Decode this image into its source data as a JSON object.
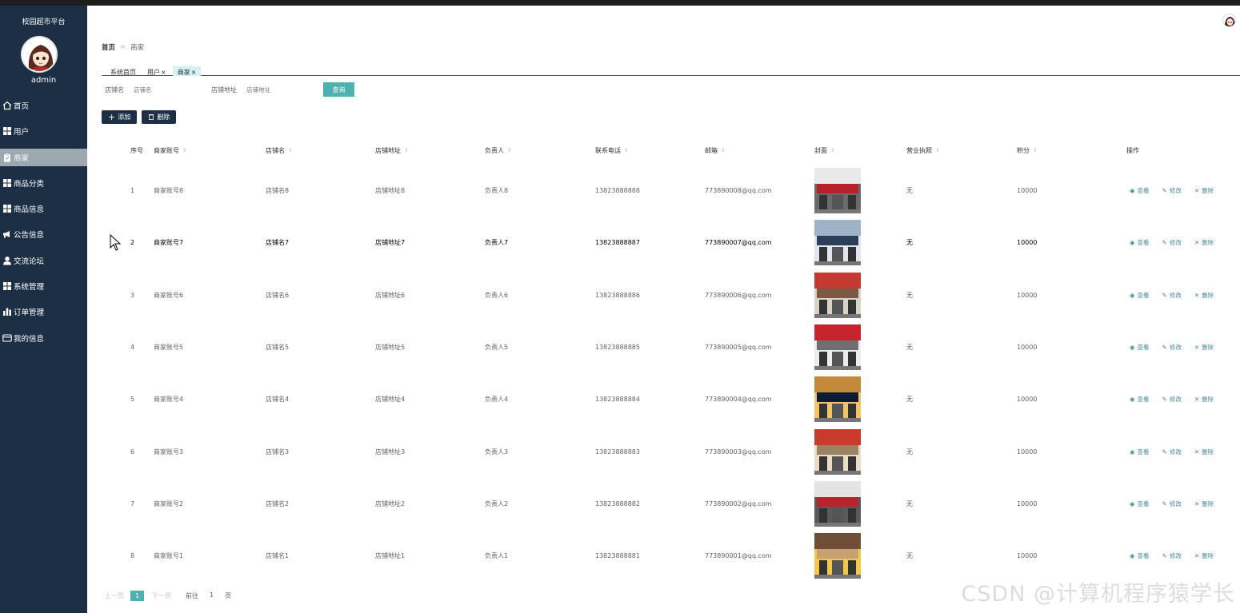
{
  "app": {
    "title": "校园超市平台",
    "user": "admin"
  },
  "menu": [
    {
      "label": "首页",
      "icon": "home-icon"
    },
    {
      "label": "用户",
      "icon": "grid-icon"
    },
    {
      "label": "商家",
      "icon": "clipboard-icon",
      "active": true
    },
    {
      "label": "商品分类",
      "icon": "grid-icon"
    },
    {
      "label": "商品信息",
      "icon": "grid-icon"
    },
    {
      "label": "公告信息",
      "icon": "megaphone-icon"
    },
    {
      "label": "交流论坛",
      "icon": "user-icon"
    },
    {
      "label": "系统管理",
      "icon": "grid-icon"
    },
    {
      "label": "订单管理",
      "icon": "bar-chart-icon"
    },
    {
      "label": "我的信息",
      "icon": "card-icon"
    }
  ],
  "breadcrumb": {
    "home": "首页",
    "separator": "≡",
    "current": "商家"
  },
  "tabs": [
    {
      "label": "系统首页",
      "closable": false
    },
    {
      "label": "用户",
      "closable": true
    },
    {
      "label": "商家",
      "closable": true,
      "active": true
    }
  ],
  "search": {
    "shop_name_label": "店铺名",
    "shop_name_placeholder": "店铺名",
    "shop_addr_label": "店铺地址",
    "shop_addr_placeholder": "店铺地址",
    "query_label": "查询"
  },
  "toolbar": {
    "add_label": "添加",
    "delete_label": "删除"
  },
  "table": {
    "headers": [
      "序号",
      "商家账号",
      "店铺名",
      "店铺地址",
      "负责人",
      "联系电话",
      "邮箱",
      "封面",
      "营业执照",
      "积分",
      "操作"
    ],
    "rows": [
      [
        "1",
        "商家账号8",
        "店铺名8",
        "店铺地址8",
        "负责人8",
        "13823888888",
        "773890008@qq.com",
        "无",
        "10000"
      ],
      [
        "2",
        "商家账号7",
        "店铺名7",
        "店铺地址7",
        "负责人7",
        "13823888887",
        "773890007@qq.com",
        "无",
        "10000"
      ],
      [
        "3",
        "商家账号6",
        "店铺名6",
        "店铺地址6",
        "负责人6",
        "13823888886",
        "773890006@qq.com",
        "无",
        "10000"
      ],
      [
        "4",
        "商家账号5",
        "店铺名5",
        "店铺地址5",
        "负责人5",
        "13823888885",
        "773890005@qq.com",
        "无",
        "10000"
      ],
      [
        "5",
        "商家账号4",
        "店铺名4",
        "店铺地址4",
        "负责人4",
        "13823888884",
        "773890004@qq.com",
        "无",
        "10000"
      ],
      [
        "6",
        "商家账号3",
        "店铺名3",
        "店铺地址3",
        "负责人3",
        "13823888883",
        "773890003@qq.com",
        "无",
        "10000"
      ],
      [
        "7",
        "商家账号2",
        "店铺名2",
        "店铺地址2",
        "负责人2",
        "13823888882",
        "773890002@qq.com",
        "无",
        "10000"
      ],
      [
        "8",
        "商家账号1",
        "店铺名1",
        "店铺地址1",
        "负责人1",
        "13823888881",
        "773890001@qq.com",
        "无",
        "10000"
      ]
    ],
    "ops": {
      "view": "查看",
      "edit": "修改",
      "del": "删除"
    },
    "cover_colors": [
      [
        "#b8202a",
        "#e9e9e9",
        "#6a6a6a"
      ],
      [
        "#2c3e5a",
        "#9fb3c8",
        "#e0e6ee"
      ],
      [
        "#7a5a44",
        "#c23a30",
        "#d9d2c6"
      ],
      [
        "#6f6f6f",
        "#c8242e",
        "#ececec"
      ],
      [
        "#101a3a",
        "#c48a3c",
        "#f2c46a"
      ],
      [
        "#9a8262",
        "#c93b2c",
        "#e8dcc4"
      ],
      [
        "#b9232c",
        "#e4e4e4",
        "#5a5a5a"
      ],
      [
        "#c7a174",
        "#6f4f36",
        "#f0c94a"
      ]
    ]
  },
  "pager": {
    "prev": "上一页",
    "current": "1",
    "next": "下一页",
    "goto": "前往",
    "page_value": "1",
    "page_unit": "页"
  },
  "watermark": "CSDN @计算机程序猿学长"
}
